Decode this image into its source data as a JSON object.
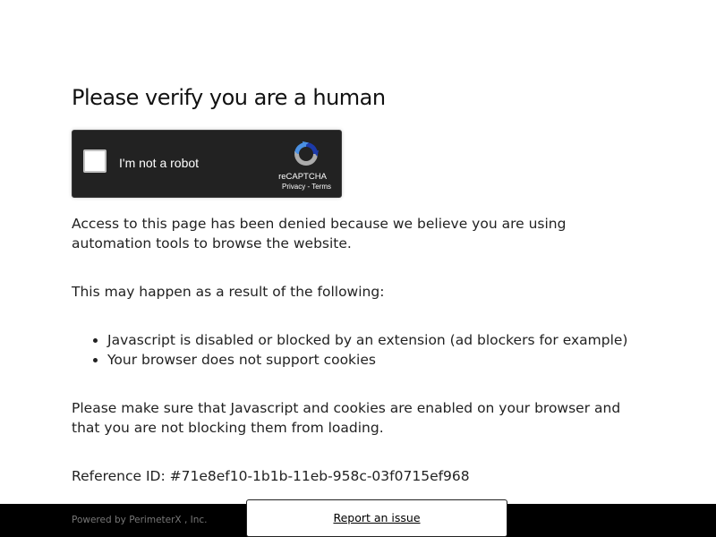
{
  "page": {
    "heading": "Please verify you are a human"
  },
  "captcha": {
    "label": "I'm not a robot",
    "brand": "reCAPTCHA",
    "privacy": "Privacy",
    "separator": " - ",
    "terms": "Terms",
    "logo_icon": "recaptcha-logo-icon"
  },
  "message": {
    "denied": "Access to this page has been denied because we believe you are using automation tools to browse the website.",
    "intro": "This may happen as a result of the following:",
    "reasons": [
      "Javascript is disabled or blocked by an extension (ad blockers for example)",
      "Your browser does not support cookies"
    ],
    "instructions": "Please make sure that Javascript and cookies are enabled on your browser and that you are not blocking them from loading.",
    "reference": "Reference ID: #71e8ef10-1b1b-11eb-958c-03f0715ef968"
  },
  "footer": {
    "powered_by": "Powered by PerimeterX , Inc.",
    "report_issue": "Report an issue"
  },
  "colors": {
    "captcha_bg": "#222222",
    "footer_bg": "#000000",
    "logo_blue": "#1c3aa9",
    "logo_light_blue": "#4a90e2",
    "logo_gray": "#ababab"
  }
}
